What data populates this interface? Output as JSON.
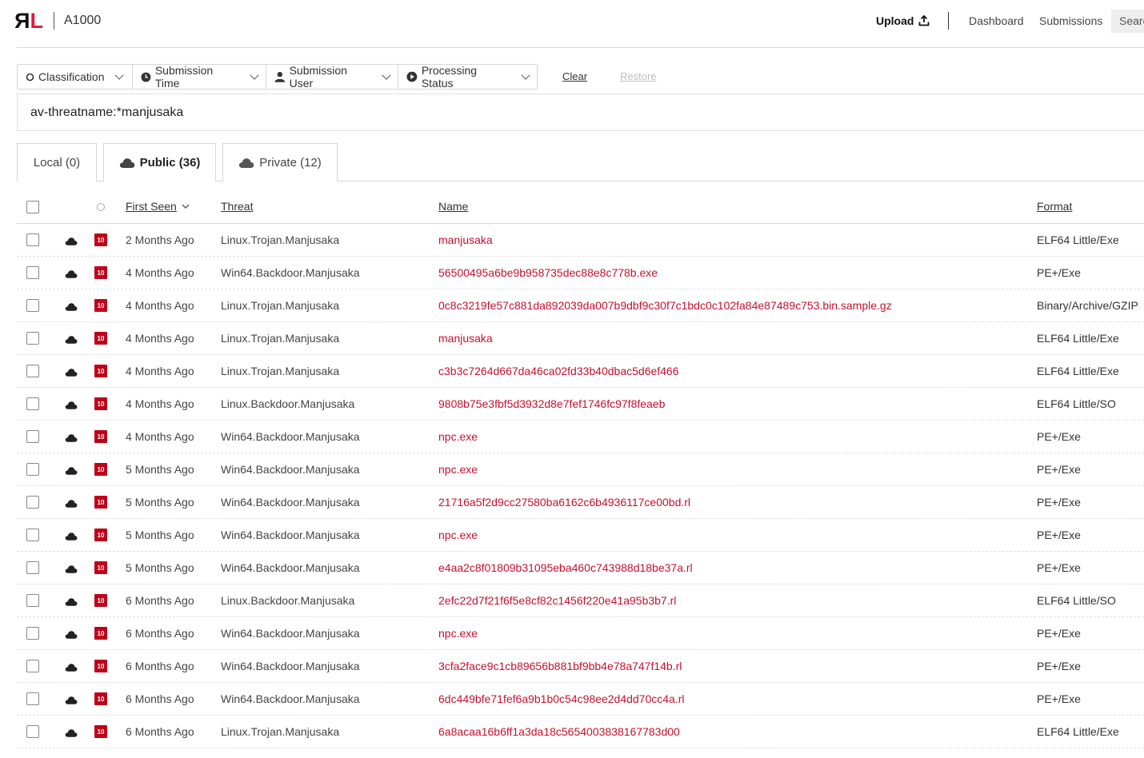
{
  "header": {
    "app_name": "A1000",
    "upload_label": "Upload",
    "nav": [
      "Dashboard",
      "Submissions"
    ],
    "search_label": "Search",
    "brand_colors": {
      "logo_red": "#e8173b",
      "logo_dark": "#111111"
    }
  },
  "filters": {
    "items": [
      {
        "label": "Classification",
        "icon": "circle-outline-icon"
      },
      {
        "label": "Submission Time",
        "icon": "clock-icon"
      },
      {
        "label": "Submission User",
        "icon": "user-icon"
      },
      {
        "label": "Processing Status",
        "icon": "play-circle-icon"
      }
    ],
    "clear_label": "Clear",
    "restore_label": "Restore"
  },
  "query": "av-threatname:*manjusaka",
  "tabs": [
    {
      "label": "Local (0)",
      "active": false,
      "icon": ""
    },
    {
      "label": "Public (36)",
      "active": true,
      "icon": "cloud-icon"
    },
    {
      "label": "Private (12)",
      "active": false,
      "icon": "cloud-icon"
    }
  ],
  "table": {
    "headers": {
      "first_seen": "First Seen",
      "threat": "Threat",
      "name": "Name",
      "format": "Format"
    },
    "risk_color": "#c00018",
    "name_color": "#c8102e",
    "rows": [
      {
        "risk": "10",
        "first_seen": "2 Months Ago",
        "threat": "Linux.Trojan.Manjusaka",
        "name": "manjusaka",
        "format": "ELF64 Little/Exe"
      },
      {
        "risk": "10",
        "first_seen": "4 Months Ago",
        "threat": "Win64.Backdoor.Manjusaka",
        "name": "56500495a6be9b958735dec88e8c778b.exe",
        "format": "PE+/Exe"
      },
      {
        "risk": "10",
        "first_seen": "4 Months Ago",
        "threat": "Linux.Trojan.Manjusaka",
        "name": "0c8c3219fe57c881da892039da007b9dbf9c30f7c1bdc0c102fa84e87489c753.bin.sample.gz",
        "format": "Binary/Archive/GZIP"
      },
      {
        "risk": "10",
        "first_seen": "4 Months Ago",
        "threat": "Linux.Trojan.Manjusaka",
        "name": "manjusaka",
        "format": "ELF64 Little/Exe"
      },
      {
        "risk": "10",
        "first_seen": "4 Months Ago",
        "threat": "Linux.Trojan.Manjusaka",
        "name": "c3b3c7264d667da46ca02fd33b40dbac5d6ef466",
        "format": "ELF64 Little/Exe"
      },
      {
        "risk": "10",
        "first_seen": "4 Months Ago",
        "threat": "Linux.Backdoor.Manjusaka",
        "name": "9808b75e3fbf5d3932d8e7fef1746fc97f8feaeb",
        "format": "ELF64 Little/SO"
      },
      {
        "risk": "10",
        "first_seen": "4 Months Ago",
        "threat": "Win64.Backdoor.Manjusaka",
        "name": "npc.exe",
        "format": "PE+/Exe"
      },
      {
        "risk": "10",
        "first_seen": "5 Months Ago",
        "threat": "Win64.Backdoor.Manjusaka",
        "name": "npc.exe",
        "format": "PE+/Exe"
      },
      {
        "risk": "10",
        "first_seen": "5 Months Ago",
        "threat": "Win64.Backdoor.Manjusaka",
        "name": "21716a5f2d9cc27580ba6162c6b4936117ce00bd.rl",
        "format": "PE+/Exe"
      },
      {
        "risk": "10",
        "first_seen": "5 Months Ago",
        "threat": "Win64.Backdoor.Manjusaka",
        "name": "npc.exe",
        "format": "PE+/Exe"
      },
      {
        "risk": "10",
        "first_seen": "5 Months Ago",
        "threat": "Win64.Backdoor.Manjusaka",
        "name": "e4aa2c8f01809b31095eba460c743988d18be37a.rl",
        "format": "PE+/Exe"
      },
      {
        "risk": "10",
        "first_seen": "6 Months Ago",
        "threat": "Linux.Backdoor.Manjusaka",
        "name": "2efc22d7f21f6f5e8cf82c1456f220e41a95b3b7.rl",
        "format": "ELF64 Little/SO"
      },
      {
        "risk": "10",
        "first_seen": "6 Months Ago",
        "threat": "Win64.Backdoor.Manjusaka",
        "name": "npc.exe",
        "format": "PE+/Exe"
      },
      {
        "risk": "10",
        "first_seen": "6 Months Ago",
        "threat": "Win64.Backdoor.Manjusaka",
        "name": "3cfa2face9c1cb89656b881bf9bb4e78a747f14b.rl",
        "format": "PE+/Exe"
      },
      {
        "risk": "10",
        "first_seen": "6 Months Ago",
        "threat": "Win64.Backdoor.Manjusaka",
        "name": "6dc449bfe71fef6a9b1b0c54c98ee2d4dd70cc4a.rl",
        "format": "PE+/Exe"
      },
      {
        "risk": "10",
        "first_seen": "6 Months Ago",
        "threat": "Linux.Trojan.Manjusaka",
        "name": "6a8acaa16b6ff1a3da18c5654003838167783d00",
        "format": "ELF64 Little/Exe"
      }
    ]
  }
}
